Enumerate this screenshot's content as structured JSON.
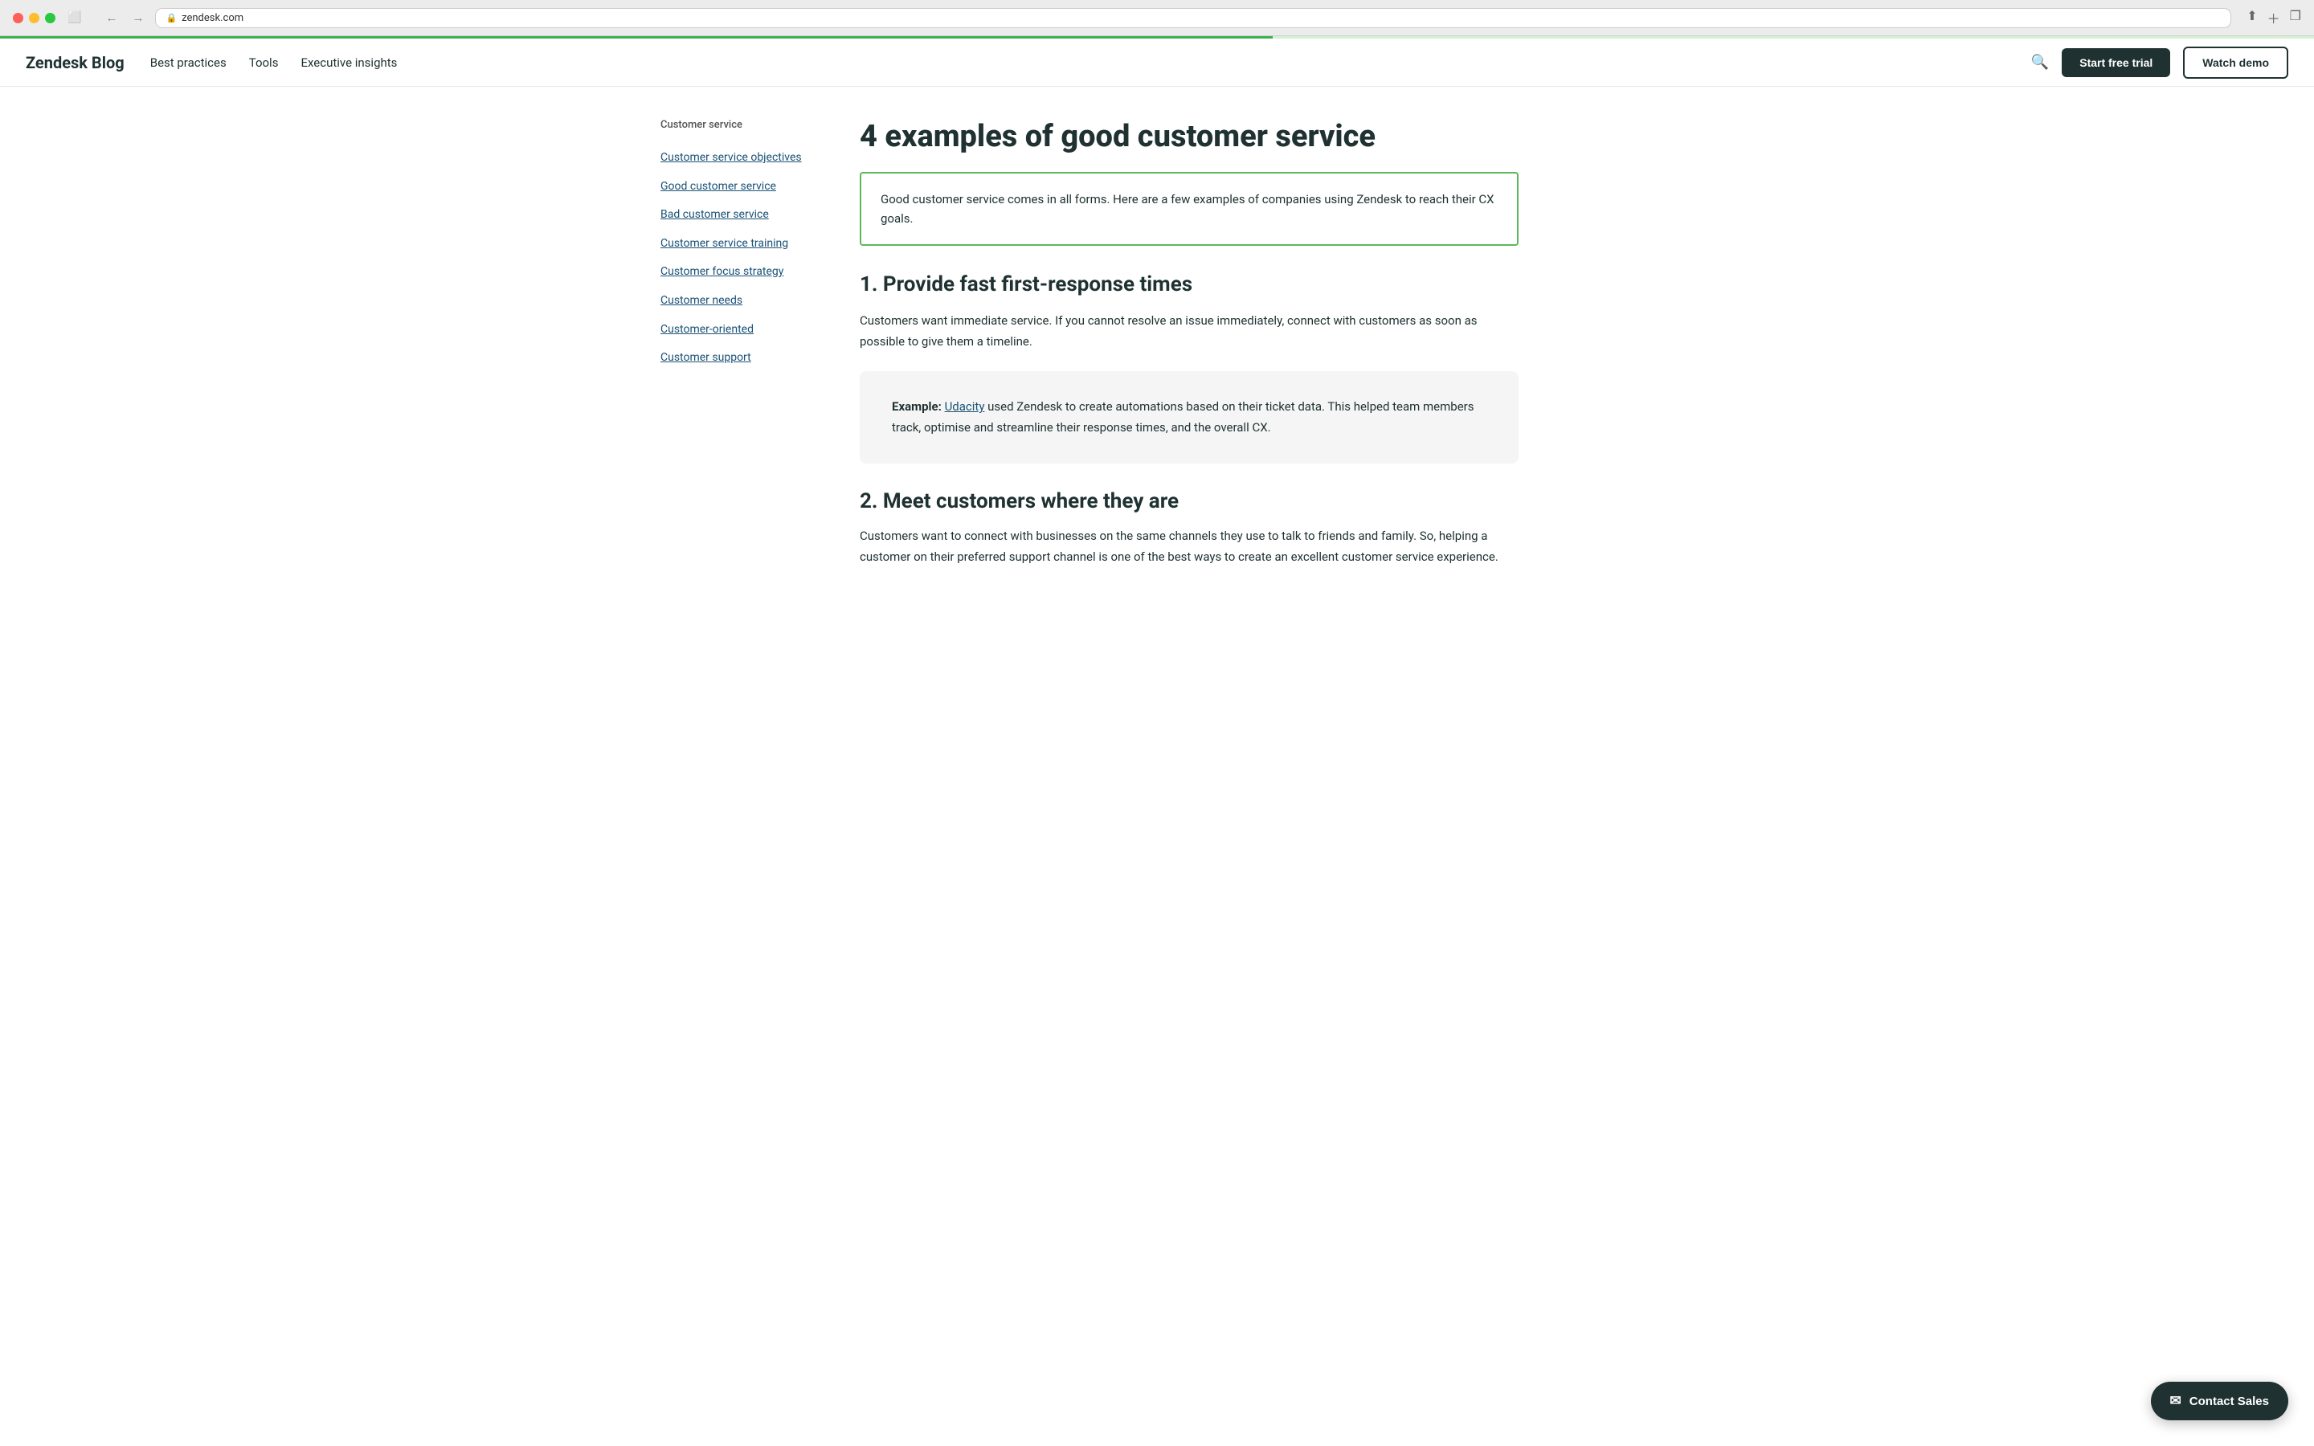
{
  "browser": {
    "url": "zendesk.com",
    "lock_icon": "🔒"
  },
  "nav": {
    "logo": "Zendesk Blog",
    "links": [
      {
        "label": "Best practices"
      },
      {
        "label": "Tools"
      },
      {
        "label": "Executive insights"
      }
    ],
    "start_free_trial": "Start free trial",
    "watch_demo": "Watch demo"
  },
  "sidebar": {
    "section_label": "Customer service",
    "links": [
      {
        "label": "Customer service objectives"
      },
      {
        "label": "Good customer service"
      },
      {
        "label": "Bad customer service"
      },
      {
        "label": "Customer service training"
      },
      {
        "label": "Customer focus strategy"
      },
      {
        "label": "Customer needs"
      },
      {
        "label": "Customer-oriented"
      },
      {
        "label": "Customer support"
      }
    ]
  },
  "article": {
    "title": "4 examples of good customer service",
    "intro": "Good customer service comes in all forms. Here are a few examples of companies using Zendesk to reach their CX goals.",
    "section1": {
      "heading": "1. Provide fast first-response times",
      "para": "Customers want immediate service. If you cannot resolve an issue immediately, connect with customers as soon as possible to give them a timeline.",
      "example_label": "Example:",
      "example_link": "Udacity",
      "example_text": " used Zendesk to create automations based on their ticket data. This helped team members track, optimise and streamline their response times, and the overall CX."
    },
    "section2": {
      "heading": "2. Meet customers where they are",
      "para": "Customers want to connect with businesses on the same channels they use to talk to friends and family. So, helping a customer on their preferred support channel is one of the best ways to create an excellent customer service experience."
    }
  },
  "fab": {
    "label": "Contact Sales",
    "icon": "✉"
  }
}
